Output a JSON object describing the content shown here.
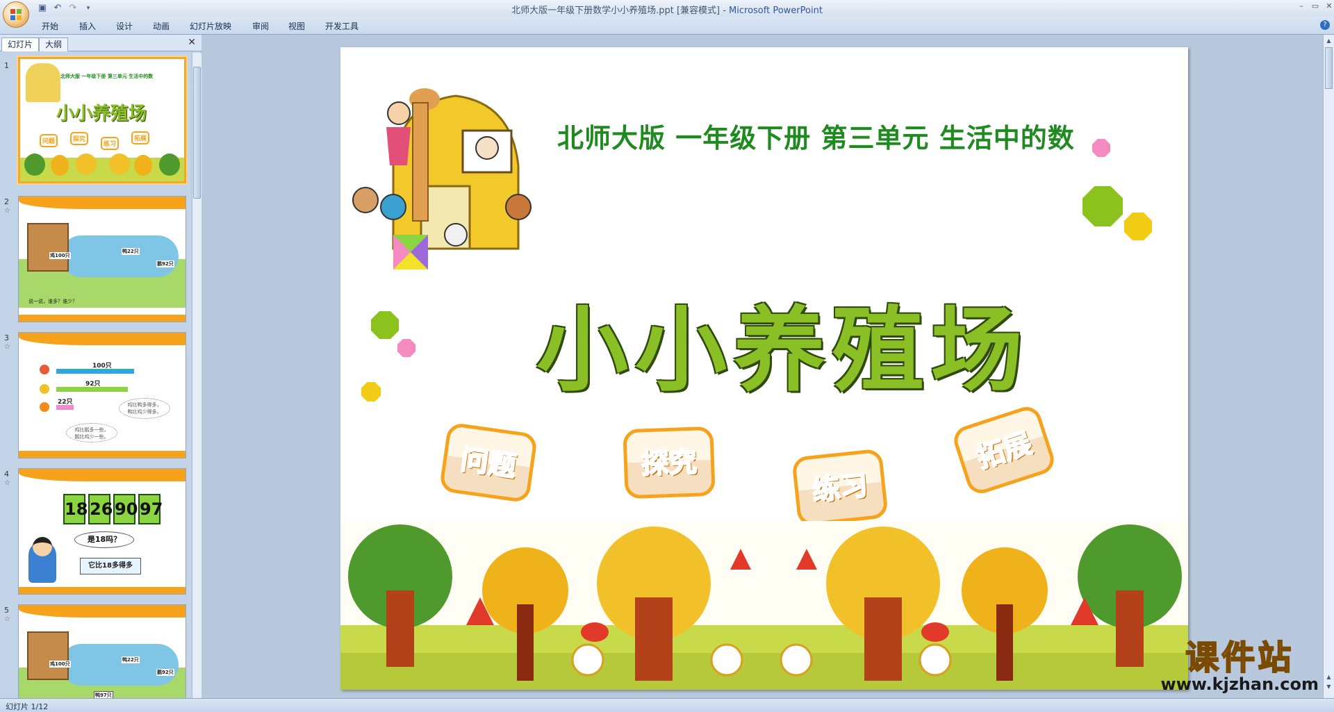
{
  "window": {
    "title": "北师大版一年级下册数学小小养殖场.ppt [兼容模式] - ",
    "app_name": "Microsoft PowerPoint"
  },
  "quick_access": {
    "save_icon": "save-icon",
    "undo_icon": "undo-icon",
    "redo_icon": "redo-icon"
  },
  "ribbon": {
    "tabs": [
      "开始",
      "插入",
      "设计",
      "动画",
      "幻灯片放映",
      "审阅",
      "视图",
      "开发工具"
    ]
  },
  "panel": {
    "tabs": [
      "幻灯片",
      "大纲"
    ],
    "close_symbol": "✕"
  },
  "thumbnails": [
    {
      "num": "1",
      "subtitle": "北师大版  一年级下册  第三单元  生活中的数",
      "title": "小小养殖场",
      "buttons": [
        "问题",
        "探究",
        "练习",
        "拓展"
      ]
    },
    {
      "num": "2",
      "star": "☆",
      "labels": [
        "鸡100只",
        "鸭22只",
        "鹅92只"
      ],
      "caption": "说一说，谁多？谁少？"
    },
    {
      "num": "3",
      "star": "☆",
      "bars": [
        {
          "label": "100只",
          "value": 100,
          "color": "#2ea8dc"
        },
        {
          "label": "92只",
          "value": 92,
          "color": "#8bd640"
        },
        {
          "label": "22只",
          "value": 22,
          "color": "#f08bd0"
        }
      ],
      "bubbles": [
        "鸡比鸭多得多，\n鸭比鸡少得多。",
        "鸡比鹅多一些，\n鹅比鸡少一些。"
      ]
    },
    {
      "num": "4",
      "star": "☆",
      "numbers": [
        "18",
        "26",
        "90",
        "97"
      ],
      "question": "是18吗？",
      "answer": "它比18多得多"
    },
    {
      "num": "5",
      "star": "☆",
      "labels": [
        "鸡100只",
        "鸭22只",
        "鹅92只",
        "鸭97只"
      ]
    }
  ],
  "slide": {
    "subtitle": "北师大版  一年级下册  第三单元  生活中的数",
    "title": "小小养殖场",
    "buttons": [
      {
        "label": "问题"
      },
      {
        "label": "探究"
      },
      {
        "label": "练习"
      },
      {
        "label": "拓展"
      }
    ]
  },
  "status_bar": {
    "slide_indicator": "幻灯片 1/12"
  },
  "watermark": {
    "brand": "课件站",
    "url": "www.kjzhan.com"
  },
  "colors": {
    "accent_orange": "#f7a21b",
    "title_green": "#8ac026",
    "subtitle_green": "#1f8a1f"
  }
}
